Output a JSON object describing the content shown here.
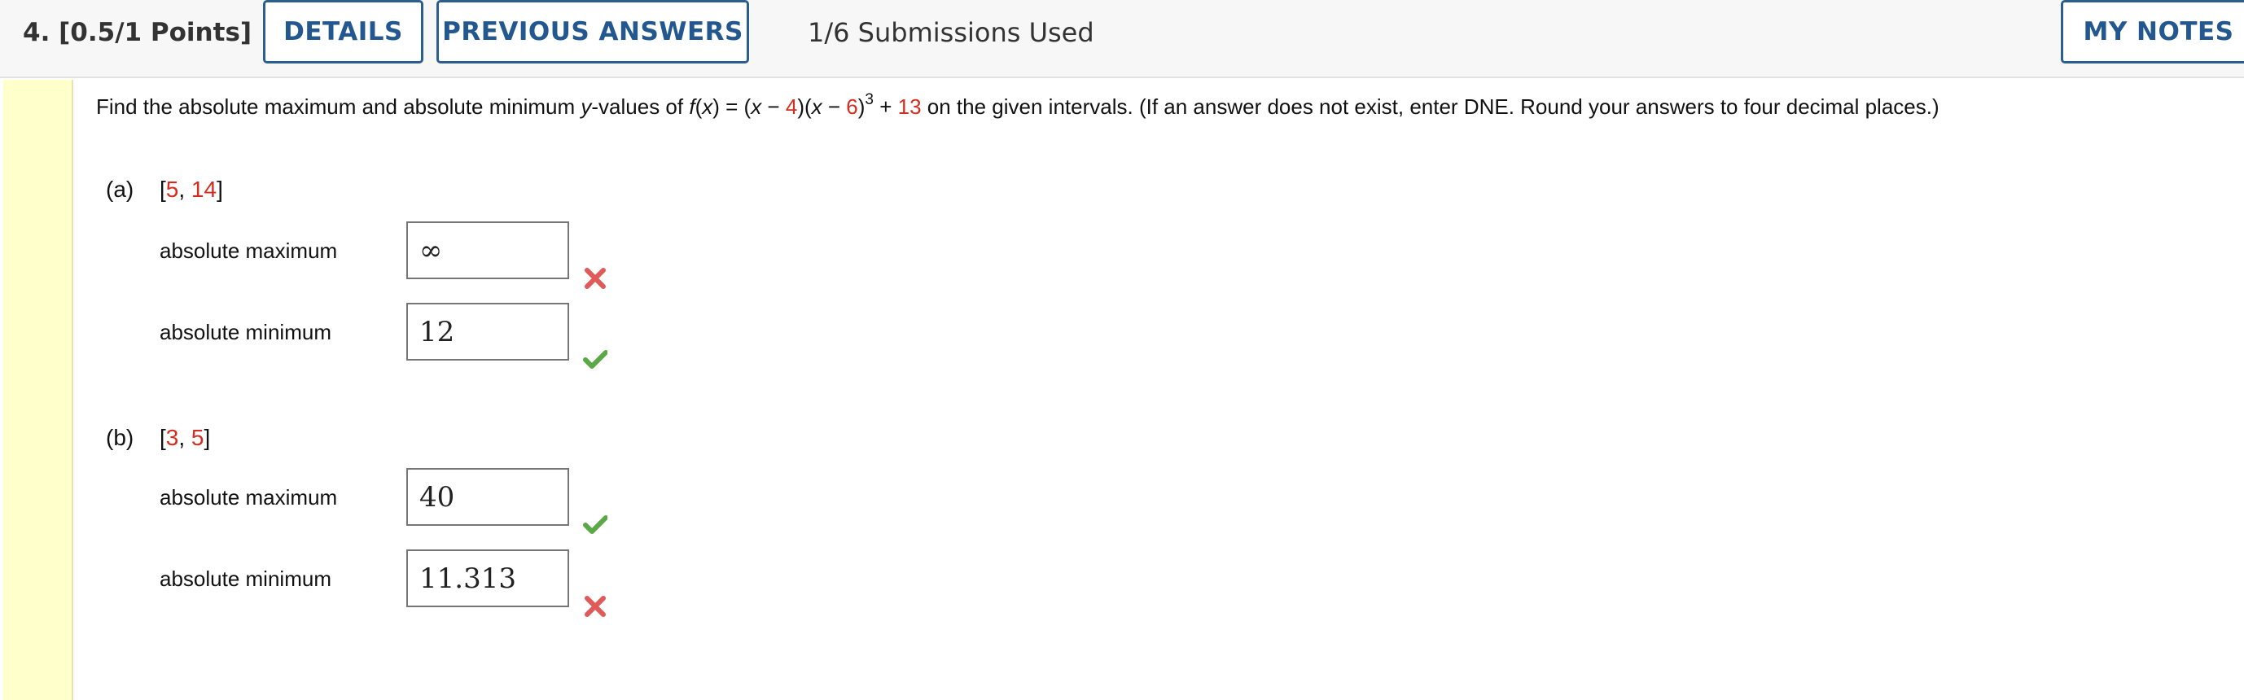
{
  "header": {
    "question_title": "4.  [0.5/1 Points]",
    "details_label": "DETAILS",
    "previous_answers_label": "PREVIOUS ANSWERS",
    "submissions": "1/6 Submissions Used",
    "my_notes_label": "MY NOTES"
  },
  "question": {
    "t1": "Find the absolute maximum and absolute minimum ",
    "y": "y",
    "t2": "-values of ",
    "f": "f",
    "t3": "(",
    "x1": "x",
    "t4": ") = (",
    "x2": "x",
    "t5": " − ",
    "n4": "4",
    "t6": ")(",
    "x3": "x",
    "t7": " − ",
    "n6": "6",
    "t8": ")",
    "exp": "3",
    "t9": " + ",
    "n13": "13",
    "t10": " on the given intervals. (If an answer does not exist, enter DNE. Round your answers to four decimal places.)"
  },
  "parts": {
    "a": {
      "label": "(a)",
      "open": "[",
      "lo": "5",
      "sep": ", ",
      "hi": "14",
      "close": "]",
      "max_label": "absolute maximum",
      "max_value": "∞",
      "max_status": "incorrect",
      "min_label": "absolute minimum",
      "min_value": "12",
      "min_status": "correct"
    },
    "b": {
      "label": "(b)",
      "open": "[",
      "lo": "3",
      "sep": ", ",
      "hi": "5",
      "close": "]",
      "max_label": "absolute maximum",
      "max_value": "40",
      "max_status": "correct",
      "min_label": "absolute minimum",
      "min_value": "11.313",
      "min_status": "incorrect"
    }
  },
  "colors": {
    "accent_blue": "#2b5d8f",
    "highlight_red": "#d42c1f",
    "correct_green": "#5aa846",
    "incorrect_red": "#e05a5a",
    "strip_yellow": "#ffffcc"
  }
}
